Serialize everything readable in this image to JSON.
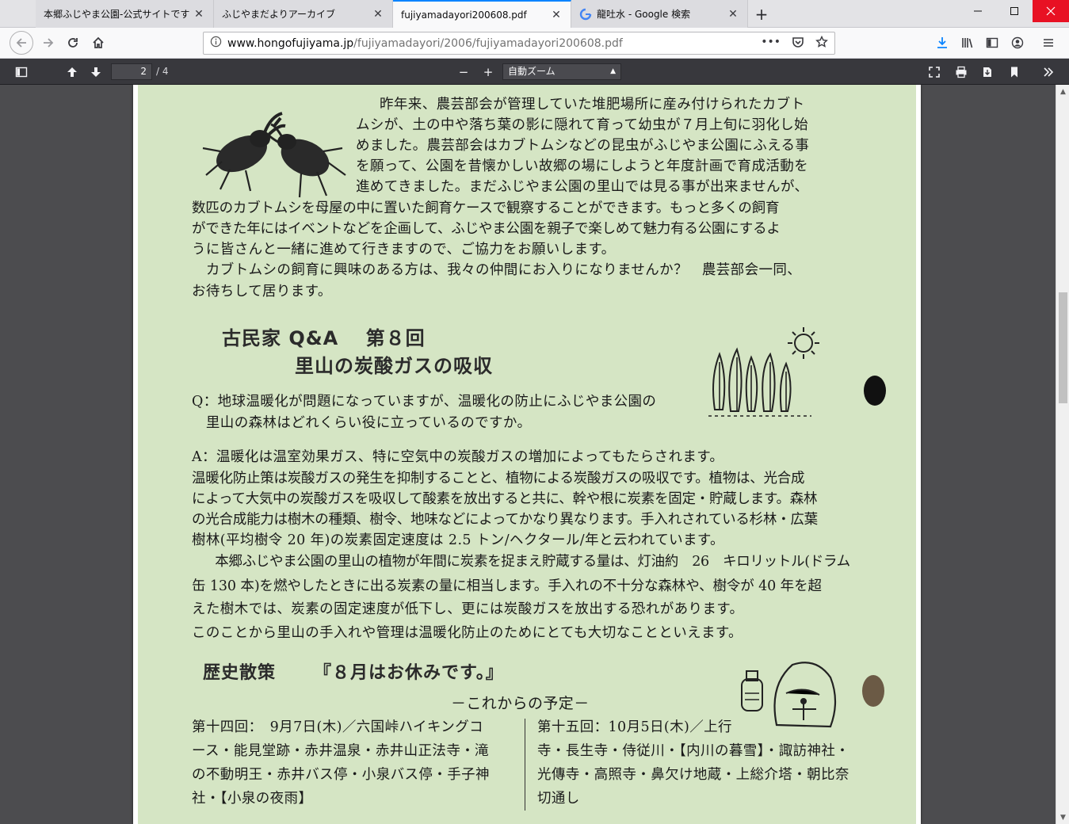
{
  "browser": {
    "tabs": [
      {
        "label": "本郷ふじやま公園-公式サイトです",
        "active": false
      },
      {
        "label": "ふじやまだよりアーカイブ",
        "active": false
      },
      {
        "label": "fujiyamadayori200608.pdf",
        "active": true
      },
      {
        "label": "龍吐水 - Google 検索",
        "active": false,
        "favicon": "G"
      }
    ],
    "new_tab": "+",
    "close_glyph": "✕",
    "url": {
      "host": "www.hongofujiyama.jp",
      "path": "/fujiyamadayori/2006/fujiyamadayori200608.pdf"
    },
    "menu_dots": "•••"
  },
  "pdf_toolbar": {
    "page_current": "2",
    "page_total": "/ 4",
    "zoom_label": "自動ズーム",
    "zoom_out": "−",
    "zoom_in": "+"
  },
  "document": {
    "intro_lines": [
      "昨年来、農芸部会が管理していた堆肥場所に産み付けられたカブト",
      "ムシが、土の中や落ち葉の影に隠れて育って幼虫が７月上旬に羽化し始",
      "めました。農芸部会はカブトムシなどの昆虫がふじやま公園にふえる事",
      "を願って、公園を昔懐かしい故郷の場にしようと年度計画で育成活動を",
      "進めてきました。まだふじやま公園の里山では見る事が出来ませんが、",
      "数匹のカブトムシを母屋の中に置いた飼育ケースで観察することができます。もっと多くの飼育",
      "ができた年にはイベントなどを企画して、ふじやま公園を親子で楽しめて魅力有る公園にするよ",
      "うに皆さんと一緒に進めて行きますので、ご協力をお願いします。",
      "　カブトムシの飼育に興味のある方は、我々の仲間にお入りになりませんか？　農芸部会一同、",
      "お待ちして居ります。"
    ],
    "qa_title_1": "古民家 Q&A　 第８回",
    "qa_title_2": "里山の炭酸ガスの吸収",
    "q_lines": [
      "Q：地球温暖化が問題になっていますが、温暖化の防止にふじやま公園の",
      "　里山の森林はどれくらい役に立っているのですか。"
    ],
    "a_lines": [
      "A：温暖化は温室効果ガス、特に空気中の炭酸ガスの増加によってもたらされます。",
      "温暖化防止策は炭酸ガスの発生を抑制することと、植物による炭酸ガスの吸収です。植物は、光合成",
      "によって大気中の炭酸ガスを吸収して酸素を放出すると共に、幹や根に炭素を固定・貯蔵します。森林",
      "の光合成能力は樹木の種類、樹令、地味などによってかなり異なります。手入れされている杉林・広葉",
      "樹林(平均樹令 20 年)の炭素固定速度は 2.5 トン/ヘクタール/年と云われています。",
      "　本郷ふじやま公園の里山の植物が年間に炭素を捉まえ貯蔵する量は、灯油約　26　キロリットル(ドラム",
      "缶 130 本)を燃やしたときに出る炭素の量に相当します。手入れの不十分な森林や、樹令が 40 年を超",
      "えた樹木では、炭素の固定速度が低下し、更には炭酸ガスを放出する恐れがあります。",
      "このことから里山の手入れや管理は温暖化防止のためにとても大切なことといえます。"
    ],
    "history_title": "歴史散策",
    "history_note": "『８月はお休みです。』",
    "schedule_title": "－これからの予定－",
    "schedule_left": [
      "第十四回：　9月7日(木)／六国峠ハイキングコ",
      "ース・能見堂跡・赤井温泉・赤井山正法寺・滝",
      "の不動明王・赤井バス停・小泉バス停・手子神",
      "社・【小泉の夜雨】"
    ],
    "schedule_right": [
      "第十五回：10月5日(木)／上行",
      "寺・長生寺・侍従川・【内川の暮雪】・諏訪神社・",
      "光傳寺・高照寺・鼻欠け地蔵・上総介塔・朝比奈",
      "切通し"
    ]
  }
}
